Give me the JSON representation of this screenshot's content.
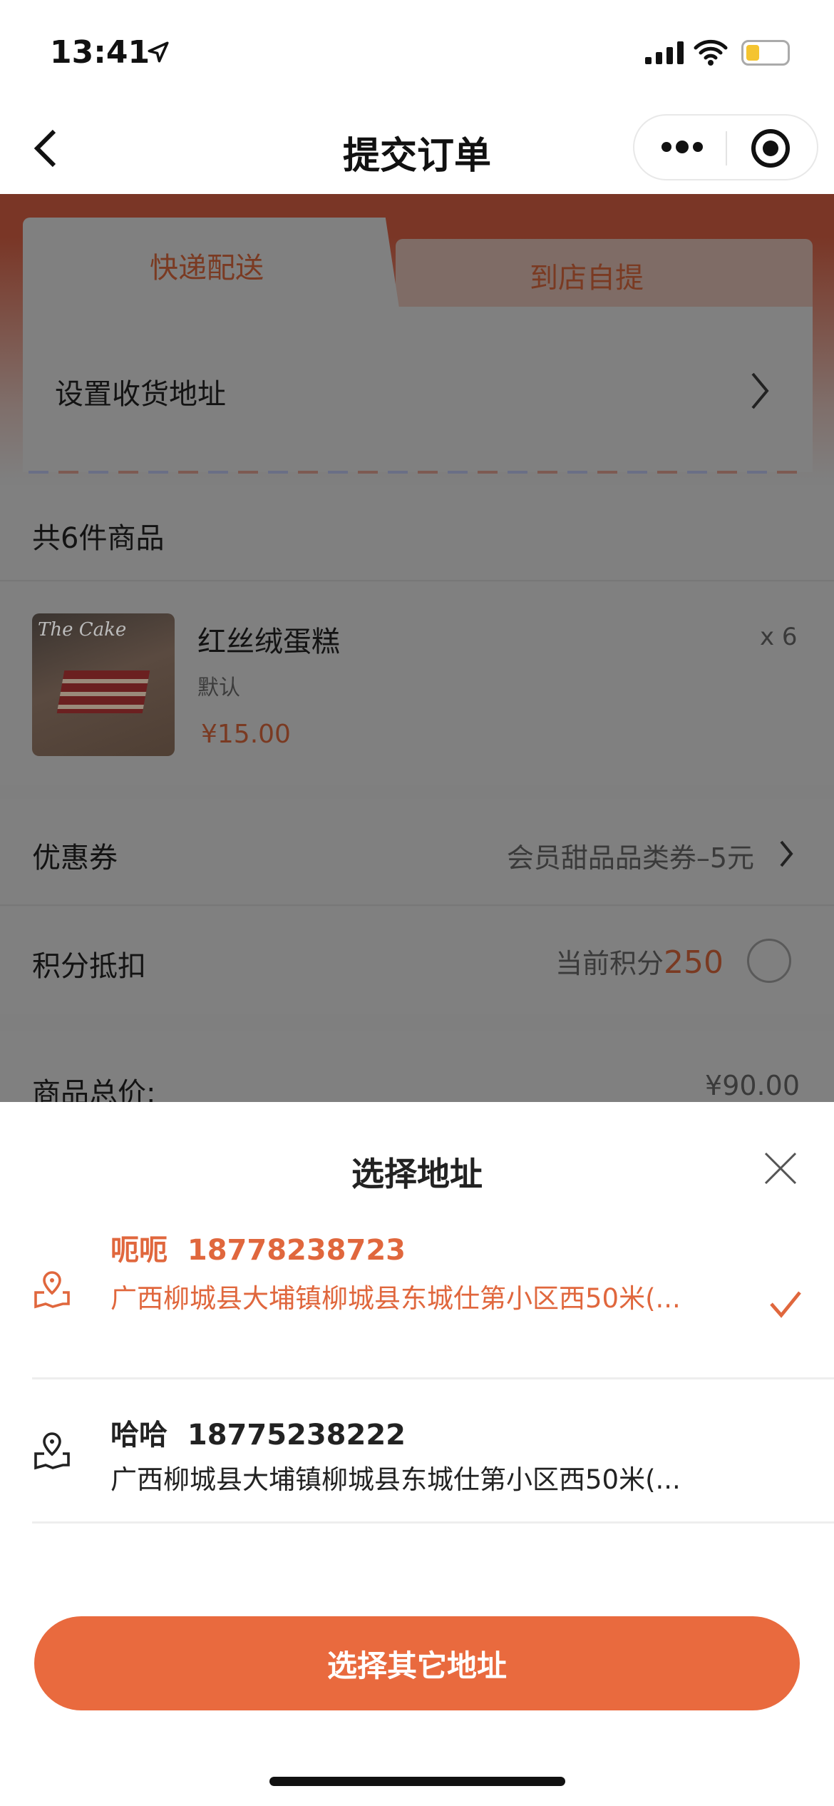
{
  "status_bar": {
    "time": "13:41"
  },
  "nav": {
    "title": "提交订单"
  },
  "delivery": {
    "tabs": [
      {
        "label": "快递配送",
        "active": true
      },
      {
        "label": "到店自提",
        "active": false
      }
    ],
    "address_placeholder": "设置收货地址"
  },
  "goods": {
    "count_label": "共6件商品",
    "item": {
      "name": "红丝绒蛋糕",
      "spec": "默认",
      "price": "¥15.00",
      "qty": "x 6",
      "image_text": "The Cake"
    }
  },
  "coupon": {
    "label": "优惠券",
    "value": "会员甜品品类券–5元"
  },
  "points": {
    "label": "积分抵扣",
    "prefix": "当前积分",
    "value": "250"
  },
  "total": {
    "label": "商品总价:",
    "value": "¥90.00"
  },
  "sheet": {
    "title": "选择地址",
    "addresses": [
      {
        "name": "呃呃",
        "phone": "18778238723",
        "address": "广西柳城县大埔镇柳城县东城仕第小区西50米(...",
        "selected": true
      },
      {
        "name": "哈哈",
        "phone": "18775238222",
        "address": "广西柳城县大埔镇柳城县东城仕第小区西50米(...",
        "selected": false
      }
    ],
    "button": "选择其它地址"
  },
  "colors": {
    "accent": "#e96a3e",
    "selected_text": "#e0673d"
  }
}
